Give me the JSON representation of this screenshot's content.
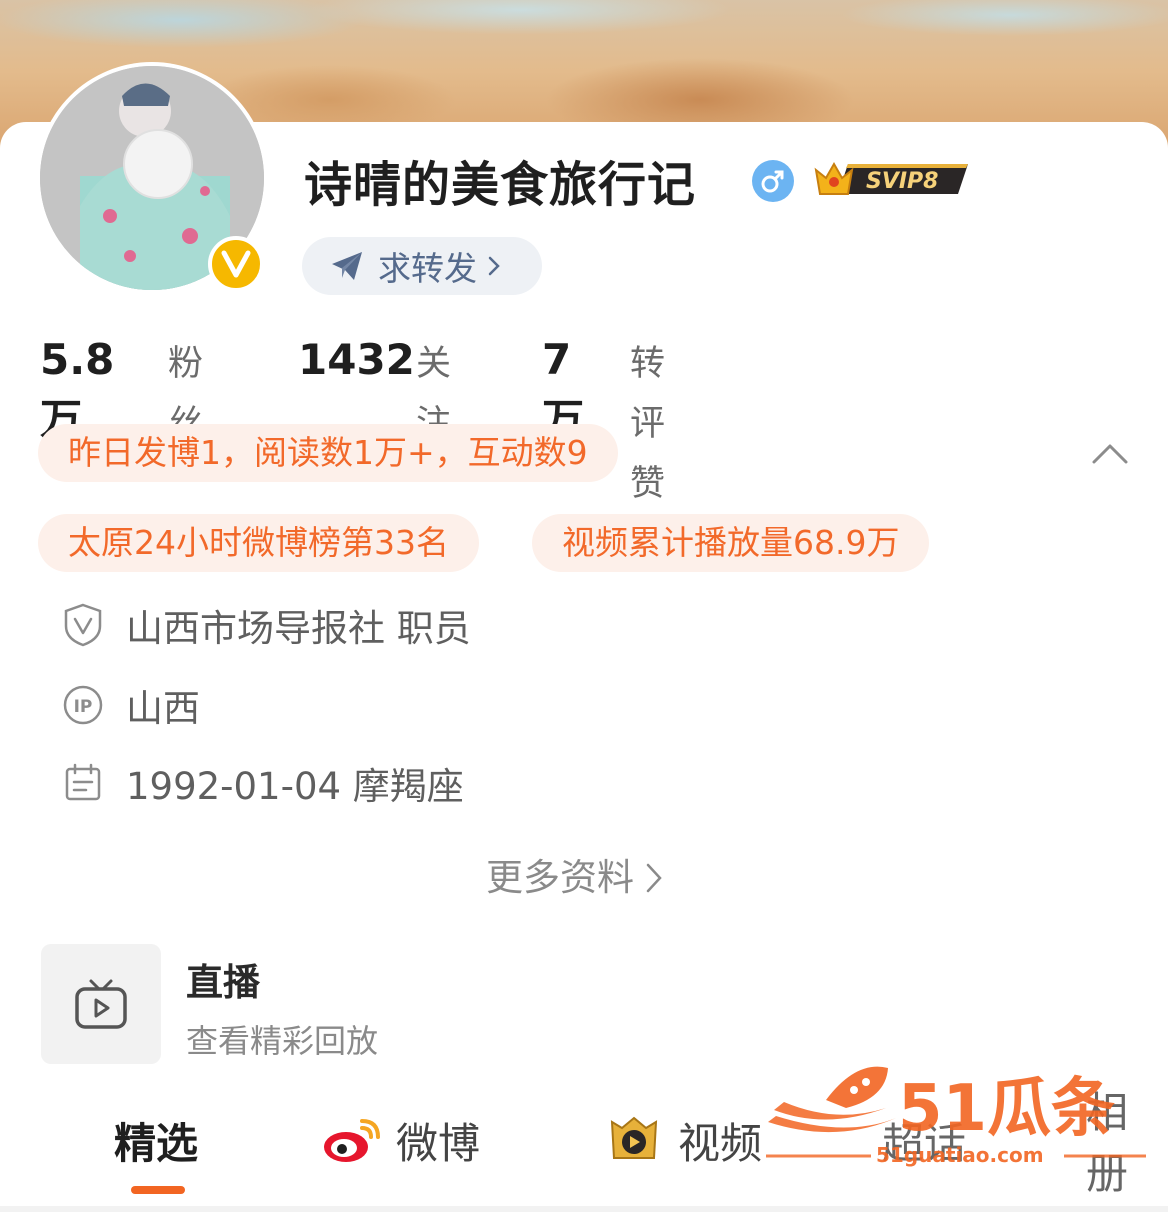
{
  "profile": {
    "name": "诗晴的美食旅行记",
    "gender_icon": "male-icon",
    "vip_badge": "SVIP8",
    "forward_button": "求转发"
  },
  "stats": [
    {
      "value": "5.8万",
      "label": "粉丝"
    },
    {
      "value": "1432",
      "label": "关注"
    },
    {
      "value": "7万",
      "label": "转评赞"
    }
  ],
  "highlights": {
    "yesterday": "昨日发博1，阅读数1万+，互动数9",
    "rank": "太原24小时微博榜第33名",
    "video_plays": "视频累计播放量68.9万"
  },
  "info": {
    "occupation": "山西市场导报社 职员",
    "ip_location": "山西",
    "birthday": "1992-01-04 摩羯座"
  },
  "more_info": "更多资料",
  "live": {
    "title": "直播",
    "subtitle": "查看精彩回放"
  },
  "tabs": [
    {
      "label": "精选"
    },
    {
      "label": "微博"
    },
    {
      "label": "视频"
    },
    {
      "label": "超话"
    },
    {
      "label": "相册"
    }
  ],
  "watermark": {
    "brand": "51瓜条",
    "url": "51guatiao.com"
  },
  "colors": {
    "accent": "#f26522",
    "pill_bg": "#fdf0ea",
    "pill_text": "#f2692a",
    "verify_gold": "#f6b800"
  }
}
